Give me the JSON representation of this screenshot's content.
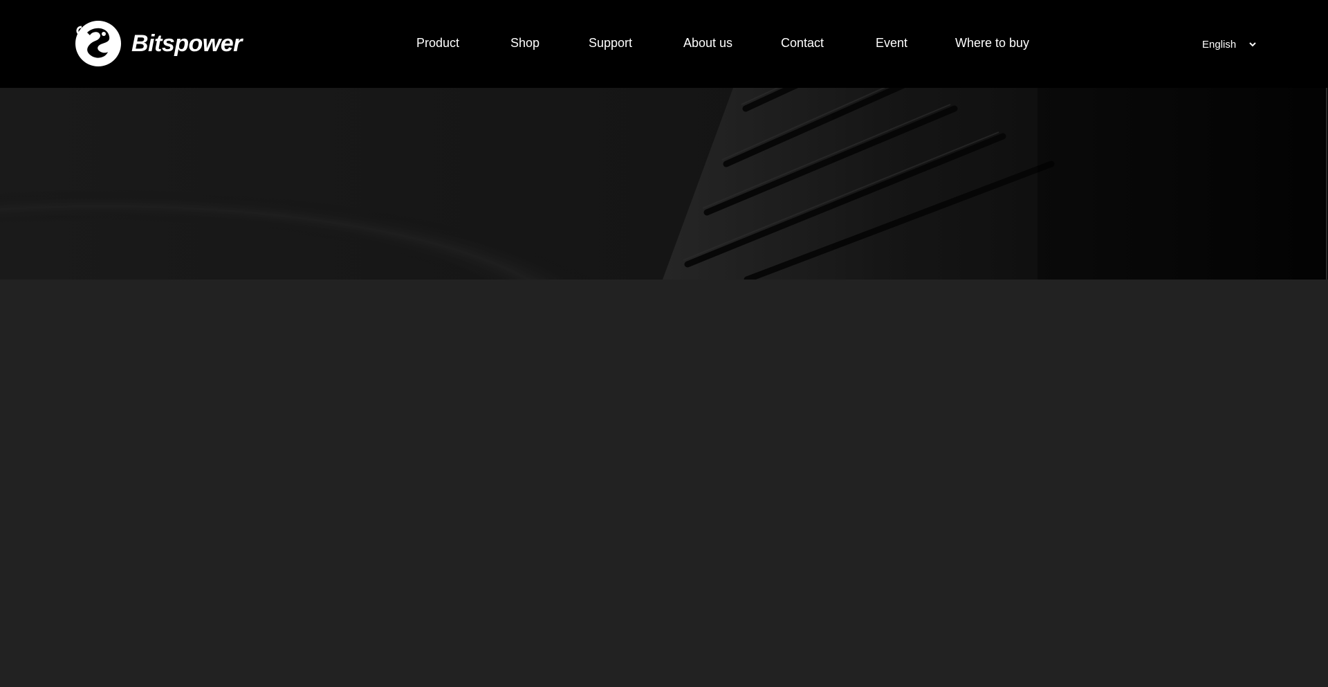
{
  "brand": {
    "name": "Bitspower"
  },
  "nav": {
    "items": [
      {
        "label": "Product"
      },
      {
        "label": "Shop"
      },
      {
        "label": "Support"
      },
      {
        "label": "About us"
      },
      {
        "label": "Contact"
      },
      {
        "label": "Event"
      },
      {
        "label": "Where to buy"
      }
    ]
  },
  "language": {
    "selected": "English"
  },
  "colors": {
    "header_bg": "#000000",
    "hero_bg": "#161616",
    "content_bg": "#222222",
    "text": "#ffffff"
  },
  "icons": {
    "logo": "dragon-emblem-icon",
    "language_toggle": "chevron-down-icon"
  }
}
